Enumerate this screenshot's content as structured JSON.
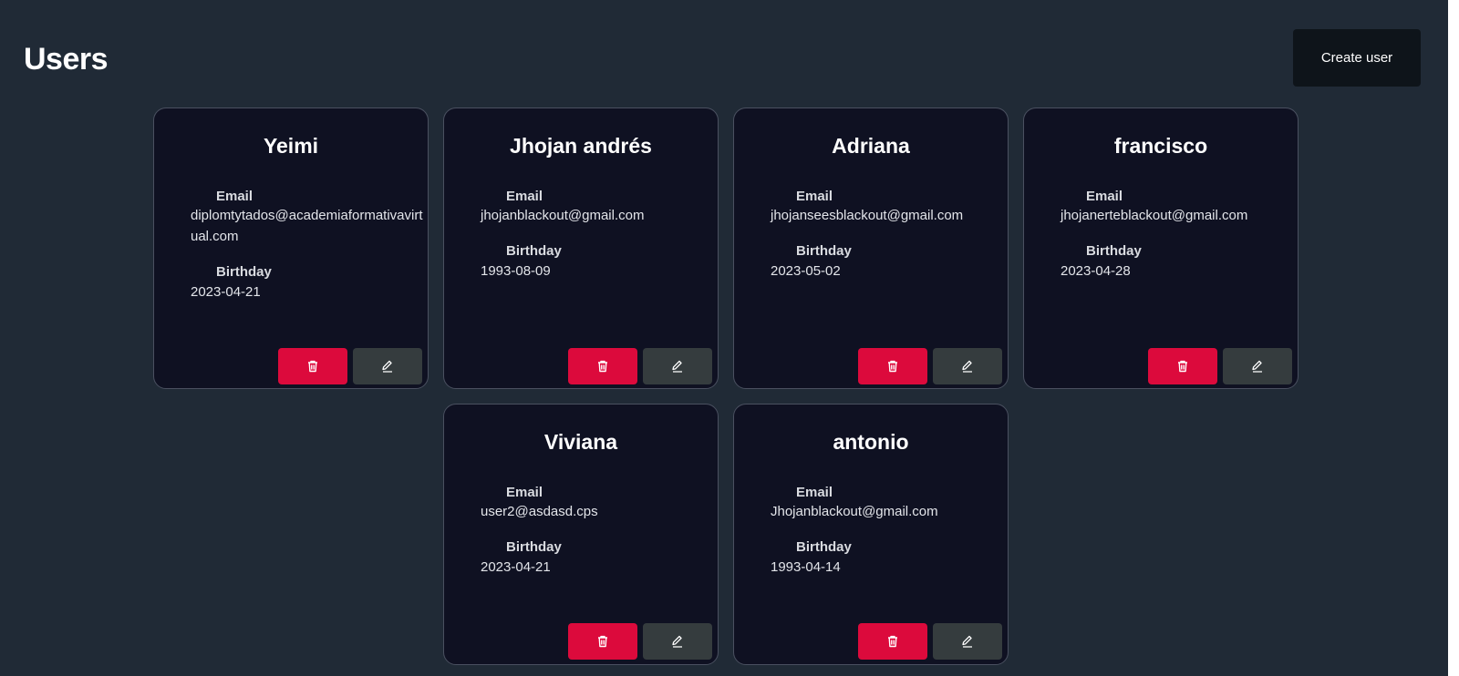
{
  "page": {
    "title": "Users",
    "create_button_label": "Create user"
  },
  "labels": {
    "email": "Email",
    "birthday": "Birthday"
  },
  "users": [
    {
      "name": "Yeimi",
      "email": "diplomtytados@academiaformativavirtual.com",
      "birthday": "2023-04-21"
    },
    {
      "name": "Jhojan andrés",
      "email": "jhojanblackout@gmail.com",
      "birthday": "1993-08-09"
    },
    {
      "name": "Adriana",
      "email": "jhojanseesblackout@gmail.com",
      "birthday": "2023-05-02"
    },
    {
      "name": "francisco",
      "email": "jhojanerteblackout@gmail.com",
      "birthday": "2023-04-28"
    },
    {
      "name": "Viviana",
      "email": "user2@asdasd.cps",
      "birthday": "2023-04-21"
    },
    {
      "name": "antonio",
      "email": "Jhojanblackout@gmail.com",
      "birthday": "1993-04-14"
    }
  ],
  "icons": {
    "delete": "trash-icon",
    "edit": "pencil-icon"
  },
  "colors": {
    "background": "#202a36",
    "card": "#0f1122",
    "delete_button": "#dc0a3c",
    "edit_button": "#353c3e",
    "create_button": "#0e141a"
  }
}
